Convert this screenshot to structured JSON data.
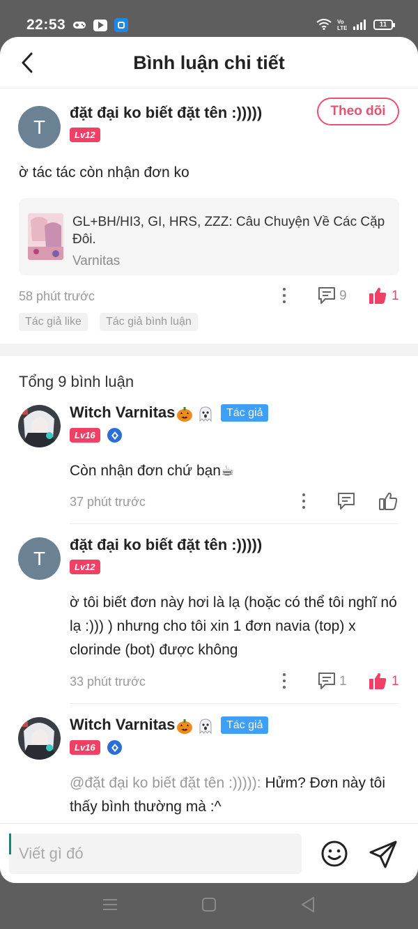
{
  "status_bar": {
    "time": "22:53",
    "battery": "11"
  },
  "header": {
    "title": "Bình luận chi tiết"
  },
  "main_comment": {
    "username": "đặt đại ko biết đặt tên :)))))",
    "level": "Lv12",
    "avatar_letter": "T",
    "follow_label": "Theo dõi",
    "text": "ờ tác tác còn nhận đơn ko",
    "story": {
      "title": "GL+BH/HI3, GI, HRS, ZZZ: Câu Chuyện Về Các Cặp Đôi.",
      "author": "Varnitas"
    },
    "time": "58 phút trước",
    "reply_count": "9",
    "like_count": "1",
    "tags": [
      "Tác giả like",
      "Tác giả bình luận"
    ]
  },
  "total_label": "Tổng 9 bình luận",
  "replies": [
    {
      "username": "Witch Varnitas",
      "level": "Lv16",
      "author_tag": "Tác giả",
      "text": "Còn nhận đơn chứ bạn☕",
      "time": "37 phút trước"
    },
    {
      "username": "đặt đại ko biết đặt tên :)))))",
      "level": "Lv12",
      "avatar_letter": "T",
      "text": "ờ tôi biết đơn này hơi là lạ (hoặc có thể tôi nghĩ nó lạ :))) ) nhưng cho tôi xin 1 đơn navia (top) x clorinde (bot) được không",
      "time": "33 phút trước",
      "reply_count": "1",
      "like_count": "1"
    },
    {
      "username": "Witch Varnitas",
      "level": "Lv16",
      "author_tag": "Tác giả",
      "mention": "@đặt đại ko biết đặt tên :))))):",
      "text": " Hửm? Đơn này tôi thấy bình thường mà :^"
    }
  ],
  "input": {
    "placeholder": "Viết gì đó"
  },
  "colors": {
    "accent": "#ef4066",
    "author_tag": "#3d9ff5",
    "avatar_t": "#6b8294"
  }
}
